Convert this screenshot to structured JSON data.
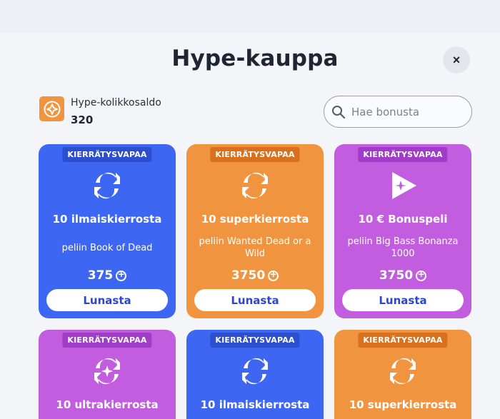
{
  "modal": {
    "title": "Hype-kauppa",
    "close_label": "×"
  },
  "balance": {
    "label": "Hype-kolikkosaldo",
    "value": "320"
  },
  "search": {
    "placeholder": "Hae bonusta"
  },
  "cards": [
    {
      "badge": "KIERRÄTYSVAPAA",
      "name": "10 ilmaiskierrosta",
      "game": "peliin Book of Dead",
      "price": "375",
      "button": "Lunasta",
      "color": "blue",
      "icon": "spins-icon"
    },
    {
      "badge": "KIERRÄTYSVAPAA",
      "name": "10 superkierrosta",
      "game": "peliin Wanted Dead or a Wild",
      "price": "3750",
      "button": "Lunasta",
      "color": "orange",
      "icon": "spins-icon"
    },
    {
      "badge": "KIERRÄTYSVAPAA",
      "name": "10 € Bonuspeli",
      "game": "peliin Big Bass Bonanza 1000",
      "price": "3750",
      "button": "Lunasta",
      "color": "purple",
      "icon": "bonus-game-icon"
    },
    {
      "badge": "KIERRÄTYSVAPAA",
      "name": "10 ultrakierrosta",
      "color": "purple",
      "icon": "spins-star-icon"
    },
    {
      "badge": "KIERRÄTYSVAPAA",
      "name": "10 ilmaiskierrosta",
      "color": "blue",
      "icon": "spins-icon"
    },
    {
      "badge": "KIERRÄTYSVAPAA",
      "name": "10 superkierrosta",
      "color": "orange",
      "icon": "spins-icon"
    }
  ],
  "colors": {
    "blue": "#3d67f2",
    "orange": "#f0943f",
    "purple": "#c25de0",
    "button_text": "#2e47c9"
  }
}
